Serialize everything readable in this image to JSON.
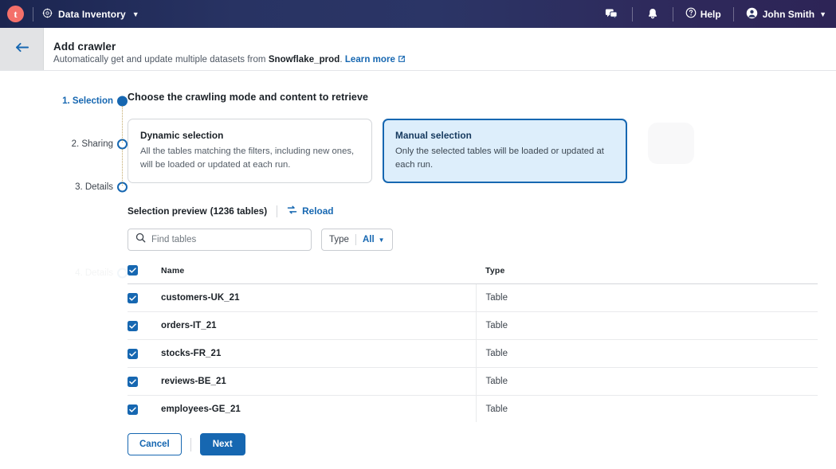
{
  "topbar": {
    "logo_letter": "t",
    "app_name": "Data Inventory",
    "chat_icon": "chat-icon",
    "bell_icon": "bell-icon",
    "help_label": "Help",
    "user_name": "John Smith"
  },
  "header": {
    "back_icon": "back-arrow-icon",
    "title": "Add crawler",
    "subtitle_prefix": "Automatically get and update multiple datasets from ",
    "subtitle_source": "Snowflake_prod",
    "subtitle_suffix": ".",
    "learn_more": "Learn more"
  },
  "stepper": {
    "steps": [
      {
        "label": "1. Selection",
        "state": "active"
      },
      {
        "label": "2. Sharing",
        "state": "pending"
      },
      {
        "label": "3. Details",
        "state": "pending"
      }
    ],
    "ghost_step": "4. Details"
  },
  "main": {
    "section_title": "Choose the crawling mode and content to retrieve",
    "modes": [
      {
        "title": "Dynamic selection",
        "description": "All the tables matching the filters, including new ones, will be loaded or updated at each run.",
        "selected": false
      },
      {
        "title": "Manual selection",
        "description": "Only the selected tables will be loaded or updated at each run.",
        "selected": true
      }
    ],
    "preview": {
      "title": "Selection preview",
      "count": "(1236 tables)",
      "reload_label": "Reload",
      "reload_icon": "refresh-icon"
    },
    "filters": {
      "search_placeholder": "Find tables",
      "search_value": "",
      "search_icon": "search-icon",
      "type_label": "Type",
      "type_value": "All",
      "type_chevron": "chevron-down-icon"
    },
    "table": {
      "select_all_checked": true,
      "columns": [
        "Name",
        "Type"
      ],
      "rows": [
        {
          "checked": true,
          "name": "customers-UK_21",
          "type": "Table"
        },
        {
          "checked": true,
          "name": "orders-IT_21",
          "type": "Table"
        },
        {
          "checked": true,
          "name": "stocks-FR_21",
          "type": "Table"
        },
        {
          "checked": true,
          "name": "reviews-BE_21",
          "type": "Table"
        },
        {
          "checked": true,
          "name": "employees-GE_21",
          "type": "Table"
        },
        {
          "checked": true,
          "name": "",
          "type": ""
        }
      ]
    },
    "footer": {
      "cancel_label": "Cancel",
      "next_label": "Next"
    }
  },
  "colors": {
    "accent": "#1667b1",
    "nav_start": "#1b2550",
    "nav_end": "#2d2456",
    "logo_bg": "#f4706a",
    "selected_card_bg": "#ddeefb"
  }
}
